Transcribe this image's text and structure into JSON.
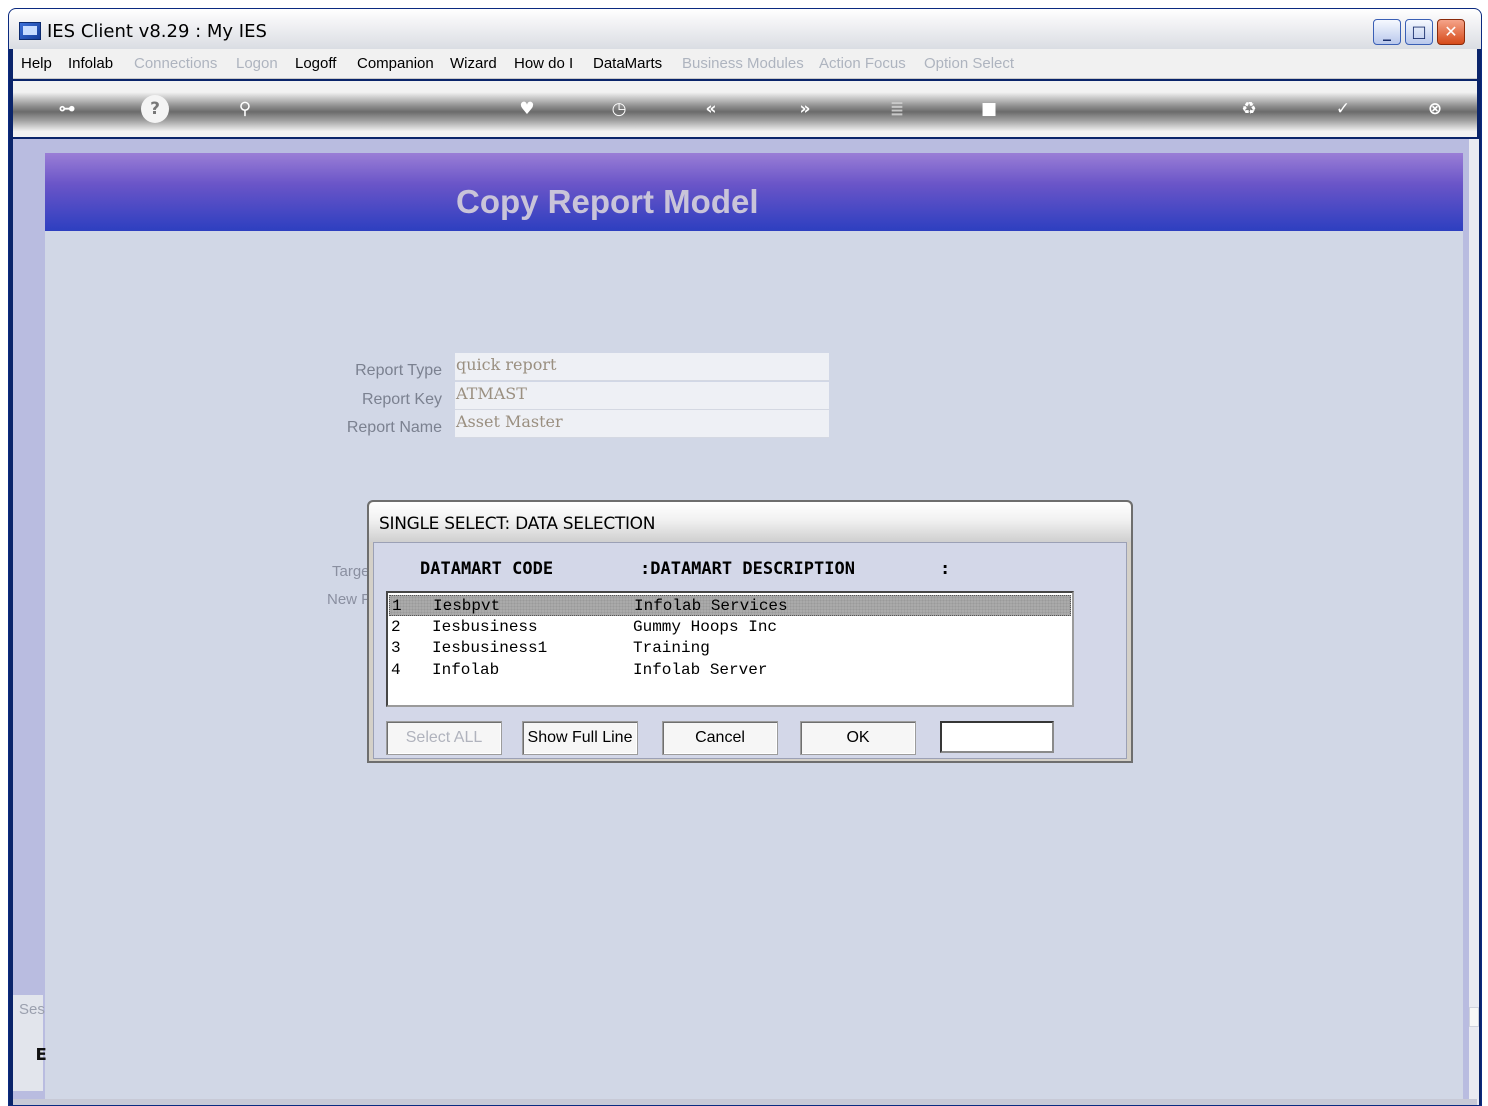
{
  "window": {
    "title": "IES Client v8.29 : My IES",
    "controls": [
      "minimize",
      "maximize",
      "close"
    ]
  },
  "menu": [
    {
      "label": "Help",
      "enabled": true
    },
    {
      "label": "Infolab",
      "enabled": true
    },
    {
      "label": "Connections",
      "enabled": false
    },
    {
      "label": "Logon",
      "enabled": false
    },
    {
      "label": "Logoff",
      "enabled": true
    },
    {
      "label": "Companion",
      "enabled": true
    },
    {
      "label": "Wizard",
      "enabled": true
    },
    {
      "label": "How do I",
      "enabled": true
    },
    {
      "label": "DataMarts",
      "enabled": true
    },
    {
      "label": "Business Modules",
      "enabled": false
    },
    {
      "label": "Action Focus",
      "enabled": false
    },
    {
      "label": "Option Select",
      "enabled": false
    }
  ],
  "toolbar": {
    "icons": [
      "key-icon",
      "help-icon",
      "search-icon",
      "heart-icon",
      "clock-icon",
      "rewind-icon",
      "forward-icon",
      "stack-icon",
      "square-icon",
      "recycle-icon",
      "check-icon",
      "close-icon"
    ]
  },
  "page": {
    "title": "Copy Report Model",
    "fields": [
      {
        "label": "Report Type",
        "value": "quick report"
      },
      {
        "label": "Report Key",
        "value": "ATMAST"
      },
      {
        "label": "Report Name",
        "value": "Asset Master"
      }
    ],
    "partial_labels": [
      "Targe",
      "New F"
    ],
    "session_label": "Ses",
    "session_icon_glyph": "ᴇ"
  },
  "dialog": {
    "title": "SINGLE SELECT: DATA SELECTION",
    "columns": {
      "code": "DATAMART CODE",
      "description": ":DATAMART DESCRIPTION",
      "trailer": ":"
    },
    "rows": [
      {
        "num": "1",
        "code": "Iesbpvt",
        "description": "Infolab Services",
        "selected": true
      },
      {
        "num": "2",
        "code": "Iesbusiness",
        "description": "Gummy Hoops Inc",
        "selected": false
      },
      {
        "num": "3",
        "code": "Iesbusiness1",
        "description": "Training",
        "selected": false
      },
      {
        "num": "4",
        "code": "Infolab",
        "description": "Infolab Server",
        "selected": false
      }
    ],
    "buttons": {
      "select_all": "Select ALL",
      "show_full_line": "Show Full Line",
      "cancel": "Cancel",
      "ok": "OK"
    },
    "input_value": ""
  },
  "colors": {
    "header_band_top": "#9a7ed6",
    "header_band_bottom": "#2d3fc0",
    "content_bg": "#d1d7e6",
    "disabled_text": "#aeb4bf"
  }
}
